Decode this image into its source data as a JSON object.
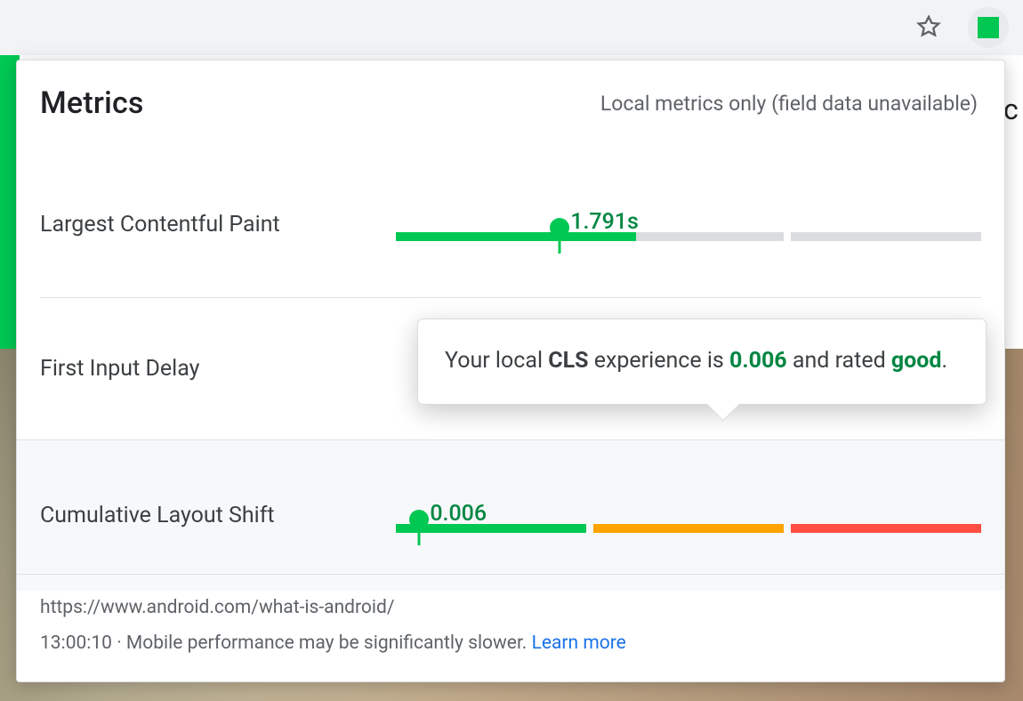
{
  "colors": {
    "good": "#00c853",
    "ok": "#ffa400",
    "bad": "#ff4e42",
    "muted": "#dadce0",
    "link": "#1a73e8",
    "text_good": "#018642"
  },
  "header": {
    "title": "Metrics",
    "note": "Local metrics only (field data unavailable)"
  },
  "metrics": [
    {
      "id": "lcp",
      "label": "Largest Contentful Paint",
      "display": "1.791s",
      "pin_pct": 28,
      "fill_pct": 41,
      "segments": [
        "good",
        "muted",
        "muted"
      ]
    },
    {
      "id": "fid",
      "label": "First Input Delay",
      "display": "",
      "pin_pct": null,
      "fill_pct": 0,
      "segments": []
    },
    {
      "id": "cls",
      "label": "Cumulative Layout Shift",
      "display": "0.006",
      "pin_pct": 4,
      "fill_pct": 1.8,
      "segments": [
        "good",
        "ok",
        "bad"
      ],
      "highlight": true
    }
  ],
  "tooltip": {
    "prefix": "Your local ",
    "metric_abbrev": "CLS",
    "mid": " experience is ",
    "value": "0.006",
    "mid2": " and rated ",
    "rating": "good",
    "suffix": "."
  },
  "footer": {
    "url": "https://www.android.com/what-is-android/",
    "time": "13:00:10",
    "sep": "  ·  ",
    "warn": "Mobile performance may be significantly slower. ",
    "learn": "Learn more"
  }
}
